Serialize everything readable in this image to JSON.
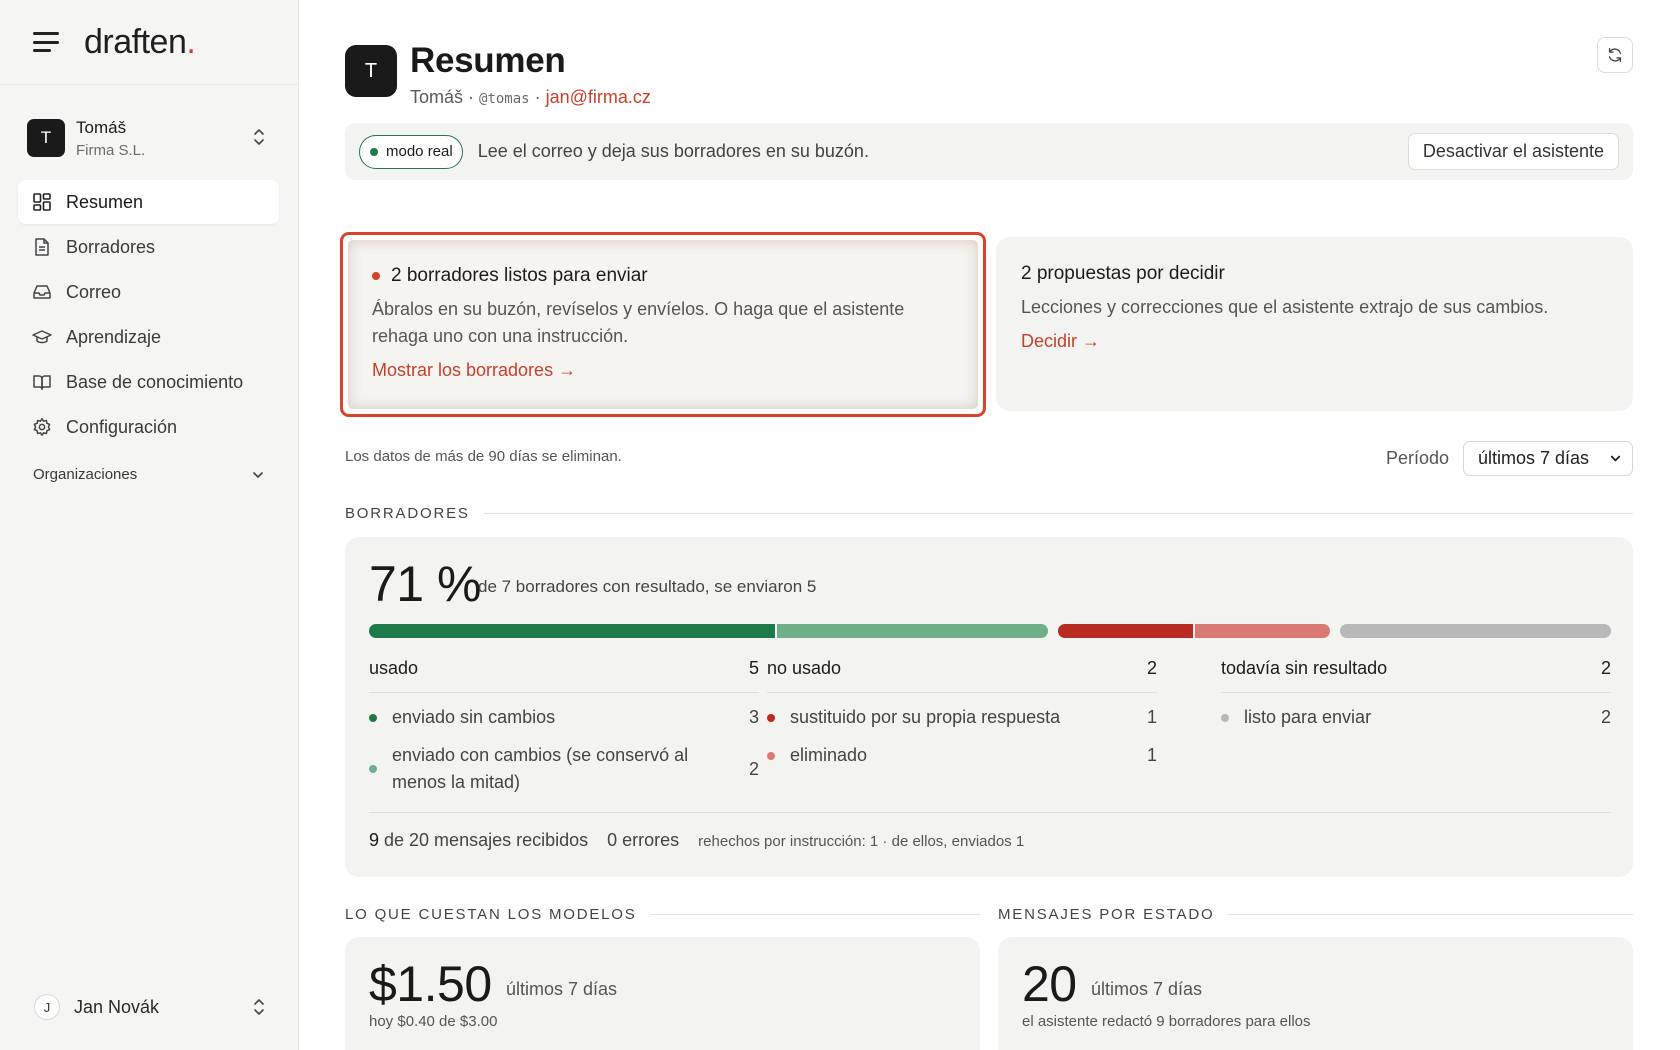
{
  "brand": {
    "name": "draften",
    "dot": "."
  },
  "account": {
    "initial": "T",
    "name": "Tomáš",
    "org": "Firma S.L."
  },
  "nav": [
    {
      "label": "Resumen",
      "icon": "dashboard-icon",
      "active": true
    },
    {
      "label": "Borradores",
      "icon": "document-icon"
    },
    {
      "label": "Correo",
      "icon": "inbox-icon"
    },
    {
      "label": "Aprendizaje",
      "icon": "graduation-cap-icon"
    },
    {
      "label": "Base de conocimiento",
      "icon": "book-open-icon"
    },
    {
      "label": "Configuración",
      "icon": "gear-icon"
    }
  ],
  "organizations_label": "Organizaciones",
  "user": {
    "initial": "J",
    "name": "Jan Novák"
  },
  "header": {
    "initial": "T",
    "title": "Resumen",
    "name": "Tomáš",
    "sep1": " · ",
    "handle": "@tomas",
    "sep2": " · ",
    "email": "jan@firma.cz"
  },
  "mode": {
    "pill": "modo real",
    "text": "Lee el correo y deja sus borradores en su buzón.",
    "deactivate": "Desactivar el asistente"
  },
  "cards": {
    "ready": {
      "title": "2 borradores listos para enviar",
      "body": "Ábralos en su buzón, revíselos y envíelos. O haga que el asistente rehaga uno con una instrucción.",
      "link": "Mostrar los borradores →"
    },
    "proposals": {
      "title": "2 propuestas por decidir",
      "body": "Lecciones y correcciones que el asistente extrajo de sus cambios.",
      "link": "Decidir →"
    }
  },
  "retention": "Los datos de más de 90 días se eliminan.",
  "period": {
    "label": "Período",
    "value": "últimos 7 días"
  },
  "drafts": {
    "section": "BORRADORES",
    "pct": "71 %",
    "note": "de 7 borradores con resultado, se enviaron 5",
    "bar": [
      {
        "value": 3,
        "color": "#1e7a4a"
      },
      {
        "value": 2,
        "color": "#6fb08b"
      },
      {
        "value": 1,
        "color": "#b82a22"
      },
      {
        "value": 1,
        "color": "#d87a72"
      },
      {
        "value": 2,
        "color": "#b8b8b8"
      }
    ],
    "groups": [
      {
        "title": "usado",
        "count": "5",
        "rows": [
          {
            "label": "enviado sin cambios",
            "count": "3",
            "color": "#1e7a4a"
          },
          {
            "label": "enviado con cambios (se conservó al menos la mitad)",
            "count": "2",
            "color": "#6fb08b"
          }
        ]
      },
      {
        "title": "no usado",
        "count": "2",
        "rows": [
          {
            "label": "sustituido por su propia respuesta",
            "count": "1",
            "color": "#b82a22"
          },
          {
            "label": "eliminado",
            "count": "1",
            "color": "#d87a72"
          }
        ]
      },
      {
        "title": "todavía sin resultado",
        "count": "2",
        "rows": [
          {
            "label": "listo para enviar",
            "count": "2",
            "color": "#b8b8b8"
          }
        ]
      }
    ],
    "footer": {
      "received_n": "9",
      "received_rest": " de 20 mensajes recibidos",
      "errors": "0 errores",
      "redone": "rehechos por instrucción: 1 · de ellos, enviados 1"
    }
  },
  "costs": {
    "section": "LO QUE CUESTAN LOS MODELOS",
    "value": "$1.50",
    "period": "últimos 7 días",
    "today": "hoy $0.40 de $3.00"
  },
  "messages": {
    "section": "MENSAJES POR ESTADO",
    "value": "20",
    "period": "últimos 7 días",
    "note": "el asistente redactó 9 borradores para ellos"
  }
}
